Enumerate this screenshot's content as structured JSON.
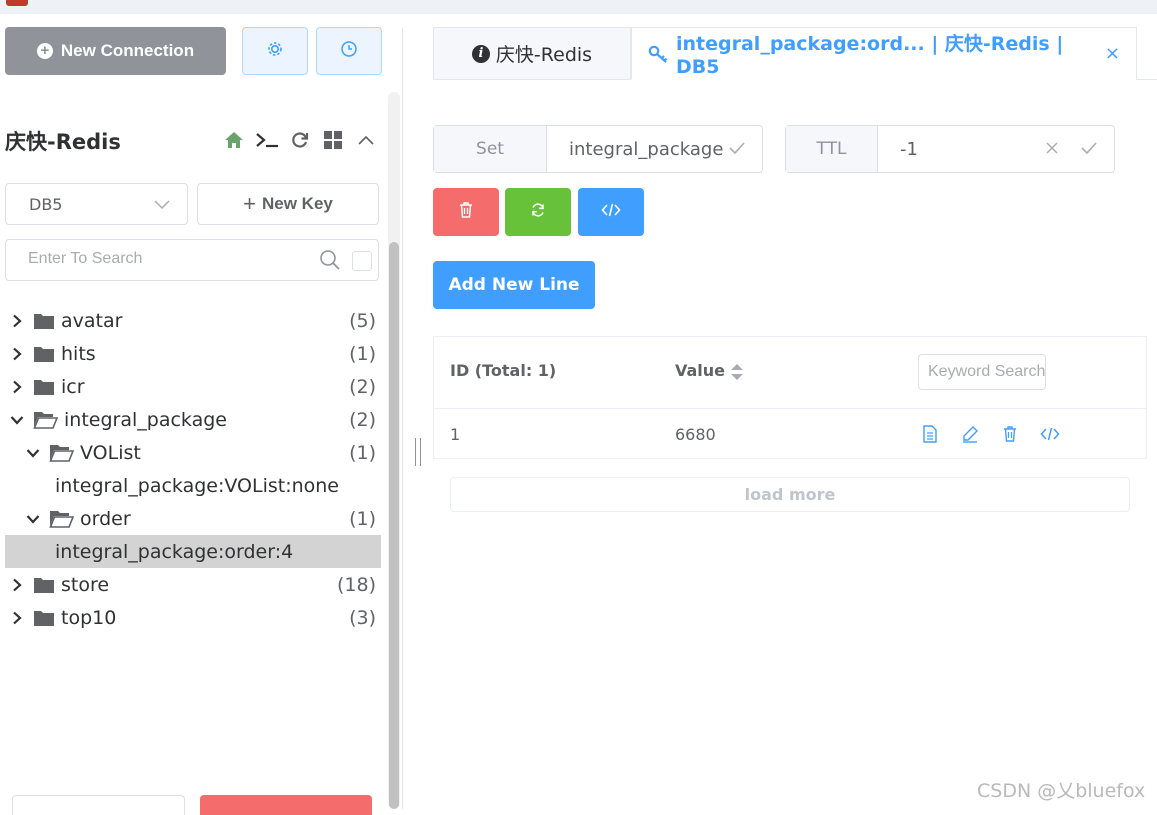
{
  "sidebar": {
    "new_connection_label": "New Connection",
    "connection_name": "庆快-Redis",
    "db_select_value": "DB5",
    "new_key_label": "New Key",
    "search_placeholder": "Enter To Search",
    "tree": [
      {
        "label": "avatar",
        "count": "(5)",
        "level": 0,
        "type": "folder",
        "expanded": false
      },
      {
        "label": "hits",
        "count": "(1)",
        "level": 0,
        "type": "folder",
        "expanded": false
      },
      {
        "label": "icr",
        "count": "(2)",
        "level": 0,
        "type": "folder",
        "expanded": false
      },
      {
        "label": "integral_package",
        "count": "(2)",
        "level": 0,
        "type": "folder",
        "expanded": true
      },
      {
        "label": "VOList",
        "count": "(1)",
        "level": 1,
        "type": "folder",
        "expanded": true
      },
      {
        "label": "integral_package:VOList:none",
        "count": "",
        "level": 2,
        "type": "key"
      },
      {
        "label": "order",
        "count": "(1)",
        "level": 1,
        "type": "folder",
        "expanded": true
      },
      {
        "label": "integral_package:order:4",
        "count": "",
        "level": 2,
        "type": "key",
        "selected": true
      },
      {
        "label": "store",
        "count": "(18)",
        "level": 0,
        "type": "folder",
        "expanded": false
      },
      {
        "label": "top10",
        "count": "(3)",
        "level": 0,
        "type": "folder",
        "expanded": false
      }
    ]
  },
  "tabs": {
    "status_tab": "庆快-Redis",
    "key_tab": "integral_package:ord... | 庆快-Redis | DB5",
    "close_glyph": "×"
  },
  "key_header": {
    "type_label": "Set",
    "key_name": "integral_package",
    "ttl_label": "TTL",
    "ttl_value": "-1"
  },
  "actions": {
    "add_new_line": "Add New Line"
  },
  "table": {
    "col_id": "ID (Total: 1)",
    "col_value": "Value",
    "keyword_placeholder": "Keyword Search",
    "rows": [
      {
        "id": "1",
        "value": "6680"
      }
    ],
    "load_more": "load more"
  },
  "watermark": "CSDN @乂bluefox",
  "colors": {
    "primary": "#409eff",
    "danger": "#f56c6c",
    "success": "#67c23a",
    "info": "#909399"
  }
}
